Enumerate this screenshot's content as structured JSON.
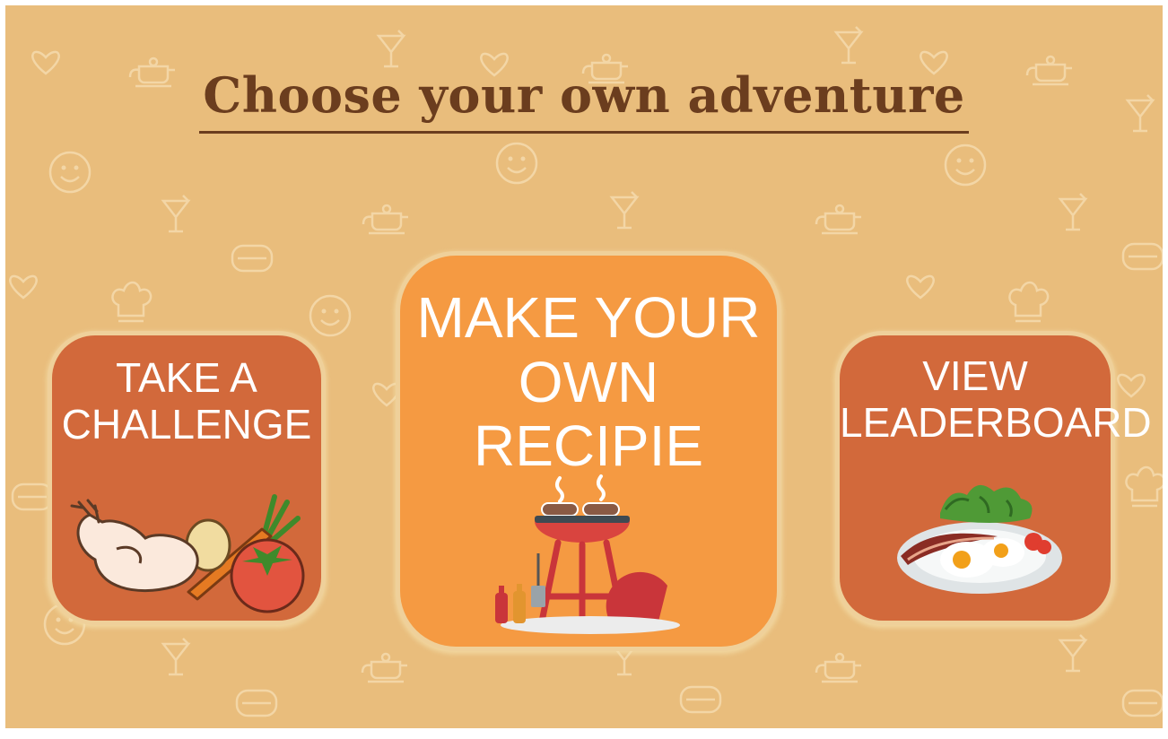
{
  "title": "Choose your own adventure",
  "cards": [
    {
      "line1": "Take a",
      "line2": "challenge",
      "illustration": "chicken-vegetables-icon"
    },
    {
      "line1": "Make your own",
      "line2": "recipie",
      "illustration": "bbq-grill-icon"
    },
    {
      "line1": "View",
      "line2": "leaderboard",
      "illustration": "breakfast-plate-icon"
    }
  ],
  "colors": {
    "background": "#e9bd7c",
    "side_card": "#d2693b",
    "main_card": "#f59a42",
    "title": "#6b3d1e"
  }
}
